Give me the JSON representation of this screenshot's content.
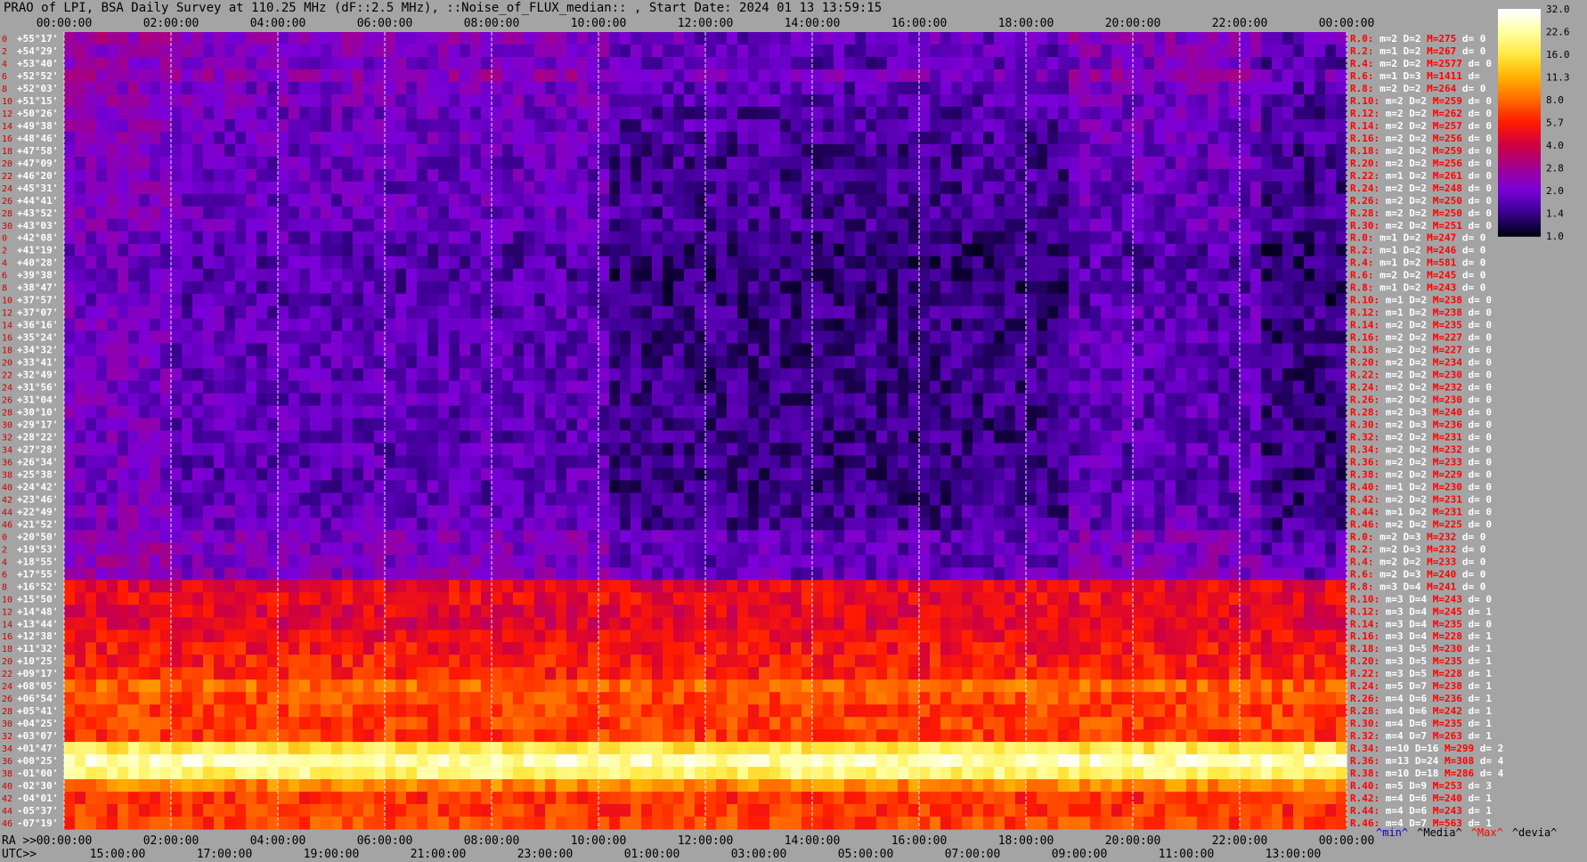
{
  "title": "PRAO of LPI, BSA Daily Survey at 110.25 MHz (dF::2.5 MHz), ::Noise_of_FLUX_median:: , Start Date: 2024 01 13 13:59:15",
  "chart_data": {
    "type": "heatmap",
    "title": "PRAO of LPI, BSA Daily Survey at 110.25 MHz (dF::2.5 MHz), ::Noise_of_FLUX_median:: , Start Date: 2024 01 13 13:59:15",
    "x_top_ticks": [
      "00:00:00",
      "02:00:00",
      "04:00:00",
      "06:00:00",
      "08:00:00",
      "10:00:00",
      "12:00:00",
      "14:00:00",
      "16:00:00",
      "18:00:00",
      "20:00:00",
      "22:00:00",
      "00:00:00"
    ],
    "x_ra_prefix": "RA >>",
    "x_ra_ticks": [
      "00:00:00",
      "02:00:00",
      "04:00:00",
      "06:00:00",
      "08:00:00",
      "10:00:00",
      "12:00:00",
      "14:00:00",
      "16:00:00",
      "18:00:00",
      "20:00:00",
      "22:00:00",
      "00:00:00"
    ],
    "x_utc_prefix": "UTC>>",
    "x_utc_ticks": [
      "15:00:00",
      "17:00:00",
      "19:00:00",
      "21:00:00",
      "23:00:00",
      "01:00:00",
      "03:00:00",
      "05:00:00",
      "07:00:00",
      "09:00:00",
      "11:00:00",
      "13:00:00"
    ],
    "colorbar_ticks": [
      "32.0",
      "22.6",
      "16.0",
      "11.3",
      "8.0",
      "5.7",
      "4.0",
      "2.8",
      "2.0",
      "1.4",
      "1.0"
    ],
    "colorbar_range": [
      1.0,
      32.0
    ],
    "colorbar_scale": "log",
    "colorbar_colors": [
      "#ffffff",
      "#ffffa0",
      "#ffe840",
      "#ffb000",
      "#ff6a00",
      "#ff1a00",
      "#d00040",
      "#a00090",
      "#7a00d8",
      "#3a0090",
      "#000018"
    ],
    "vertical_gridlines": true,
    "rows": [
      {
        "idx": "0",
        "dec": "+55°17'",
        "stat": "R.0: m=2 D=2 M=275 d= 0",
        "base": 2.2
      },
      {
        "idx": "2",
        "dec": "+54°29'",
        "stat": "R.2: m=1 D=2 M=267 d= 0",
        "base": 2.1
      },
      {
        "idx": "4",
        "dec": "+53°40'",
        "stat": "R.4: m=2 D=2 M=2577 d= 0",
        "base": 2.0
      },
      {
        "idx": "6",
        "dec": "+52°52'",
        "stat": "R.6: m=1 D=3 M=1411 d=",
        "base": 2.4
      },
      {
        "idx": "8",
        "dec": "+52°03'",
        "stat": "R.8: m=2 D=2 M=264 d= 0",
        "base": 2.0
      },
      {
        "idx": "10",
        "dec": "+51°15'",
        "stat": "R.10: m=2 D=2 M=259 d= 0",
        "base": 2.0
      },
      {
        "idx": "12",
        "dec": "+50°26'",
        "stat": "R.12: m=2 D=2 M=262 d= 0",
        "base": 1.9
      },
      {
        "idx": "14",
        "dec": "+49°38'",
        "stat": "R.14: m=2 D=2 M=257 d= 0",
        "base": 1.9
      },
      {
        "idx": "16",
        "dec": "+48°46'",
        "stat": "R.16: m=2 D=2 M=256 d= 0",
        "base": 1.9
      },
      {
        "idx": "18",
        "dec": "+47°58'",
        "stat": "R.18: m=2 D=2 M=259 d= 0",
        "base": 1.8
      },
      {
        "idx": "20",
        "dec": "+47°09'",
        "stat": "R.20: m=2 D=2 M=256 d= 0",
        "base": 1.8
      },
      {
        "idx": "22",
        "dec": "+46°20'",
        "stat": "R.22: m=1 D=2 M=261 d= 0",
        "base": 1.8
      },
      {
        "idx": "24",
        "dec": "+45°31'",
        "stat": "R.24: m=2 D=2 M=248 d= 0",
        "base": 1.8
      },
      {
        "idx": "26",
        "dec": "+44°41'",
        "stat": "R.26: m=2 D=2 M=250 d= 0",
        "base": 1.8
      },
      {
        "idx": "28",
        "dec": "+43°52'",
        "stat": "R.28: m=2 D=2 M=250 d= 0",
        "base": 1.8
      },
      {
        "idx": "30",
        "dec": "+43°03'",
        "stat": "R.30: m=2 D=2 M=251 d= 0",
        "base": 1.8
      },
      {
        "idx": "0",
        "dec": "+42°08'",
        "stat": "R.0: m=1 D=2 M=247 d= 0",
        "base": 1.7
      },
      {
        "idx": "2",
        "dec": "+41°19'",
        "stat": "R.2: m=1 D=2 M=246 d= 0",
        "base": 1.6
      },
      {
        "idx": "4",
        "dec": "+40°28'",
        "stat": "R.4: m=1 D=2 M=581 d= 0",
        "base": 1.6
      },
      {
        "idx": "6",
        "dec": "+39°38'",
        "stat": "R.6: m=2 D=2 M=245 d= 0",
        "base": 1.6
      },
      {
        "idx": "8",
        "dec": "+38°47'",
        "stat": "R.8: m=1 D=2 M=243 d= 0",
        "base": 1.6
      },
      {
        "idx": "10",
        "dec": "+37°57'",
        "stat": "R.10: m=1 D=2 M=238 d= 0",
        "base": 1.6
      },
      {
        "idx": "12",
        "dec": "+37°07'",
        "stat": "R.12: m=1 D=2 M=238 d= 0",
        "base": 1.7
      },
      {
        "idx": "14",
        "dec": "+36°16'",
        "stat": "R.14: m=2 D=2 M=235 d= 0",
        "base": 1.7
      },
      {
        "idx": "16",
        "dec": "+35°24'",
        "stat": "R.16: m=2 D=2 M=227 d= 0",
        "base": 1.7
      },
      {
        "idx": "18",
        "dec": "+34°32'",
        "stat": "R.18: m=2 D=2 M=227 d= 0",
        "base": 1.7
      },
      {
        "idx": "20",
        "dec": "+33°41'",
        "stat": "R.20: m=2 D=2 M=234 d= 0",
        "base": 1.7
      },
      {
        "idx": "22",
        "dec": "+32°49'",
        "stat": "R.22: m=2 D=2 M=230 d= 0",
        "base": 1.7
      },
      {
        "idx": "24",
        "dec": "+31°56'",
        "stat": "R.24: m=2 D=2 M=232 d= 0",
        "base": 1.7
      },
      {
        "idx": "26",
        "dec": "+31°04'",
        "stat": "R.26: m=2 D=2 M=230 d= 0",
        "base": 1.7
      },
      {
        "idx": "28",
        "dec": "+30°10'",
        "stat": "R.28: m=2 D=3 M=240 d= 0",
        "base": 1.7
      },
      {
        "idx": "30",
        "dec": "+29°17'",
        "stat": "R.30: m=2 D=3 M=236 d= 0",
        "base": 1.7
      },
      {
        "idx": "32",
        "dec": "+28°22'",
        "stat": "R.32: m=2 D=2 M=231 d= 0",
        "base": 1.7
      },
      {
        "idx": "34",
        "dec": "+27°28'",
        "stat": "R.34: m=2 D=2 M=232 d= 0",
        "base": 1.7
      },
      {
        "idx": "36",
        "dec": "+26°34'",
        "stat": "R.36: m=2 D=2 M=233 d= 0",
        "base": 1.7
      },
      {
        "idx": "38",
        "dec": "+25°38'",
        "stat": "R.38: m=2 D=2 M=229 d= 0",
        "base": 1.7
      },
      {
        "idx": "40",
        "dec": "+24°42'",
        "stat": "R.40: m=1 D=2 M=230 d= 0",
        "base": 1.7
      },
      {
        "idx": "42",
        "dec": "+23°46'",
        "stat": "R.42: m=2 D=2 M=231 d= 0",
        "base": 1.7
      },
      {
        "idx": "44",
        "dec": "+22°49'",
        "stat": "R.44: m=1 D=2 M=231 d= 0",
        "base": 1.8
      },
      {
        "idx": "46",
        "dec": "+21°52'",
        "stat": "R.46: m=2 D=2 M=225 d= 0",
        "base": 1.8
      },
      {
        "idx": "0",
        "dec": "+20°50'",
        "stat": "R.0: m=2 D=3 M=232 d= 0",
        "base": 2.1
      },
      {
        "idx": "2",
        "dec": "+19°53'",
        "stat": "R.2: m=2 D=3 M=232 d= 0",
        "base": 2.1
      },
      {
        "idx": "4",
        "dec": "+18°55'",
        "stat": "R.4: m=2 D=2 M=233 d= 0",
        "base": 2.1
      },
      {
        "idx": "6",
        "dec": "+17°55'",
        "stat": "R.6: m=2 D=3 M=240 d= 0",
        "base": 2.2
      },
      {
        "idx": "8",
        "dec": "+16°52'",
        "stat": "R.8: m=3 D=4 M=241 d= 0",
        "base": 4.6
      },
      {
        "idx": "10",
        "dec": "+15°50'",
        "stat": "R.10: m=3 D=4 M=243 d= 0",
        "base": 4.8
      },
      {
        "idx": "12",
        "dec": "+14°48'",
        "stat": "R.12: m=3 D=4 M=245 d= 1",
        "base": 4.5
      },
      {
        "idx": "14",
        "dec": "+13°44'",
        "stat": "R.14: m=3 D=4 M=235 d= 0",
        "base": 4.4
      },
      {
        "idx": "16",
        "dec": "+12°38'",
        "stat": "R.16: m=3 D=4 M=228 d= 1",
        "base": 4.8
      },
      {
        "idx": "18",
        "dec": "+11°32'",
        "stat": "R.18: m=3 D=5 M=230 d= 1",
        "base": 5.2
      },
      {
        "idx": "20",
        "dec": "+10°25'",
        "stat": "R.20: m=3 D=5 M=235 d= 1",
        "base": 5.5
      },
      {
        "idx": "22",
        "dec": "+09°17'",
        "stat": "R.22: m=3 D=5 M=228 d= 1",
        "base": 5.6
      },
      {
        "idx": "24",
        "dec": "+08°05'",
        "stat": "R.24: m=5 D=7 M=238 d= 1",
        "base": 7.8
      },
      {
        "idx": "26",
        "dec": "+06°54'",
        "stat": "R.26: m=4 D=6 M=236 d= 1",
        "base": 6.8
      },
      {
        "idx": "28",
        "dec": "+05°41'",
        "stat": "R.28: m=4 D=6 M=242 d= 1",
        "base": 6.6
      },
      {
        "idx": "30",
        "dec": "+04°25'",
        "stat": "R.30: m=4 D=6 M=235 d= 1",
        "base": 6.6
      },
      {
        "idx": "32",
        "dec": "+03°07'",
        "stat": "R.32: m=4 D=7 M=263 d= 1",
        "base": 6.4
      },
      {
        "idx": "34",
        "dec": "+01°47'",
        "stat": "R.34: m=10 D=16 M=299 d= 2",
        "base": 16.5
      },
      {
        "idx": "36",
        "dec": "+00°25'",
        "stat": "R.36: m=13 D=24 M=308 d= 4",
        "base": 24
      },
      {
        "idx": "38",
        "dec": "-01°00'",
        "stat": "R.38: m=10 D=18 M=286 d= 4",
        "base": 19
      },
      {
        "idx": "40",
        "dec": "-02°30'",
        "stat": "R.40: m=5 D=9 M=253 d= 3",
        "base": 9
      },
      {
        "idx": "42",
        "dec": "-04°01'",
        "stat": "R.42: m=4 D=6 M=240 d= 1",
        "base": 6.2
      },
      {
        "idx": "44",
        "dec": "-05°37'",
        "stat": "R.44: m=4 D=6 M=243 d= 1",
        "base": 6.2
      },
      {
        "idx": "46",
        "dec": "-07°19'",
        "stat": "R.46: m=4 D=7 M=563 d= 1",
        "base": 6.6
      }
    ]
  },
  "bottom_legend": {
    "min": "^min^",
    "median": "^Media^",
    "max": "^Max^",
    "dev": "^devia^"
  },
  "colors": {
    "background": "#a4a4a4",
    "index_label": "#cc0000",
    "dec_label": "#ffffff",
    "stat_red": "#ff0000",
    "stat_white": "#ffffff",
    "gridline": "#ffffff"
  }
}
